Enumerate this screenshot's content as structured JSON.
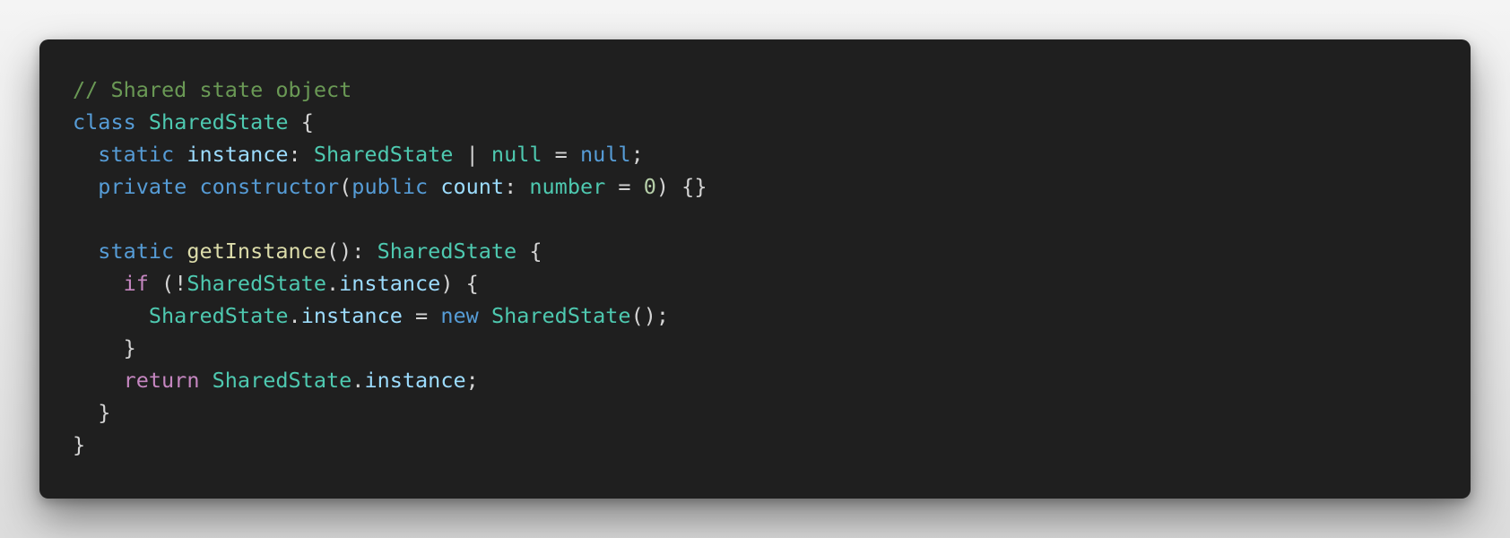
{
  "code_block": {
    "language": "typescript",
    "theme_colors": {
      "background": "#1f1f1f",
      "comment": "#6a9955",
      "keyword": "#569cd6",
      "control": "#c586c0",
      "type": "#4ec9b0",
      "variable": "#9cdcfe",
      "function": "#dcdcaa",
      "number": "#b5cea8",
      "punctuation": "#d4d4d4"
    },
    "lines": [
      [
        {
          "kind": "comment",
          "text": "// Shared state object"
        }
      ],
      [
        {
          "kind": "keyword",
          "text": "class"
        },
        {
          "kind": "punct",
          "text": " "
        },
        {
          "kind": "type",
          "text": "SharedState"
        },
        {
          "kind": "punct",
          "text": " {"
        }
      ],
      [
        {
          "kind": "punct",
          "text": "  "
        },
        {
          "kind": "keyword",
          "text": "static"
        },
        {
          "kind": "punct",
          "text": " "
        },
        {
          "kind": "variable",
          "text": "instance"
        },
        {
          "kind": "punct",
          "text": ": "
        },
        {
          "kind": "type",
          "text": "SharedState"
        },
        {
          "kind": "punct",
          "text": " | "
        },
        {
          "kind": "type",
          "text": "null"
        },
        {
          "kind": "punct",
          "text": " = "
        },
        {
          "kind": "keyword",
          "text": "null"
        },
        {
          "kind": "punct",
          "text": ";"
        }
      ],
      [
        {
          "kind": "punct",
          "text": "  "
        },
        {
          "kind": "keyword",
          "text": "private"
        },
        {
          "kind": "punct",
          "text": " "
        },
        {
          "kind": "keyword",
          "text": "constructor"
        },
        {
          "kind": "punct",
          "text": "("
        },
        {
          "kind": "keyword",
          "text": "public"
        },
        {
          "kind": "punct",
          "text": " "
        },
        {
          "kind": "variable",
          "text": "count"
        },
        {
          "kind": "punct",
          "text": ": "
        },
        {
          "kind": "type",
          "text": "number"
        },
        {
          "kind": "punct",
          "text": " = "
        },
        {
          "kind": "number",
          "text": "0"
        },
        {
          "kind": "punct",
          "text": ") {}"
        }
      ],
      [],
      [
        {
          "kind": "punct",
          "text": "  "
        },
        {
          "kind": "keyword",
          "text": "static"
        },
        {
          "kind": "punct",
          "text": " "
        },
        {
          "kind": "function",
          "text": "getInstance"
        },
        {
          "kind": "punct",
          "text": "(): "
        },
        {
          "kind": "type",
          "text": "SharedState"
        },
        {
          "kind": "punct",
          "text": " {"
        }
      ],
      [
        {
          "kind": "punct",
          "text": "    "
        },
        {
          "kind": "control",
          "text": "if"
        },
        {
          "kind": "punct",
          "text": " (!"
        },
        {
          "kind": "type",
          "text": "SharedState"
        },
        {
          "kind": "punct",
          "text": "."
        },
        {
          "kind": "variable",
          "text": "instance"
        },
        {
          "kind": "punct",
          "text": ") {"
        }
      ],
      [
        {
          "kind": "punct",
          "text": "      "
        },
        {
          "kind": "type",
          "text": "SharedState"
        },
        {
          "kind": "punct",
          "text": "."
        },
        {
          "kind": "variable",
          "text": "instance"
        },
        {
          "kind": "punct",
          "text": " = "
        },
        {
          "kind": "keyword",
          "text": "new"
        },
        {
          "kind": "punct",
          "text": " "
        },
        {
          "kind": "type",
          "text": "SharedState"
        },
        {
          "kind": "punct",
          "text": "();"
        }
      ],
      [
        {
          "kind": "punct",
          "text": "    }"
        }
      ],
      [
        {
          "kind": "punct",
          "text": "    "
        },
        {
          "kind": "control",
          "text": "return"
        },
        {
          "kind": "punct",
          "text": " "
        },
        {
          "kind": "type",
          "text": "SharedState"
        },
        {
          "kind": "punct",
          "text": "."
        },
        {
          "kind": "variable",
          "text": "instance"
        },
        {
          "kind": "punct",
          "text": ";"
        }
      ],
      [
        {
          "kind": "punct",
          "text": "  }"
        }
      ],
      [
        {
          "kind": "punct",
          "text": "}"
        }
      ]
    ]
  }
}
